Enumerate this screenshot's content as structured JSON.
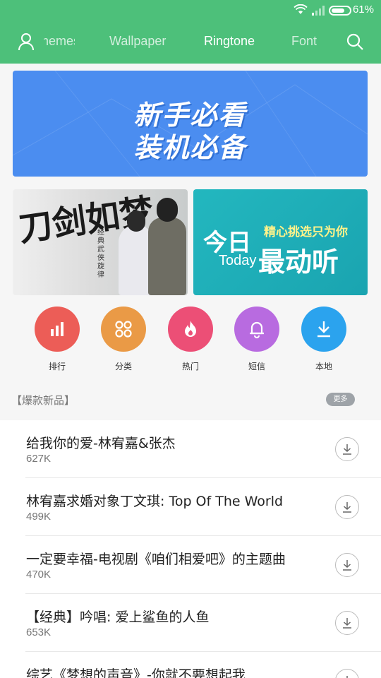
{
  "status_bar": {
    "battery_percent": "61%"
  },
  "nav": {
    "tabs": [
      {
        "label": "Themes"
      },
      {
        "label": "Wallpaper"
      },
      {
        "label": "Ringtone"
      },
      {
        "label": "Font"
      }
    ],
    "active_tab": "Ringtone"
  },
  "banners": {
    "main": {
      "line1": "新手必看",
      "line2": "装机必备"
    },
    "left": {
      "title": "刀剑如梦",
      "subtitle": "经典武侠旋律"
    },
    "right": {
      "line1": "今日",
      "sub": "精心挑选只为你",
      "today": "Today",
      "line2": "最动听"
    }
  },
  "categories": [
    {
      "label": "排行",
      "icon": "bar-chart-icon",
      "color": "#ec5d57"
    },
    {
      "label": "分类",
      "icon": "grid-icon",
      "color": "#ea9a46"
    },
    {
      "label": "热门",
      "icon": "flame-icon",
      "color": "#ec4f76"
    },
    {
      "label": "短信",
      "icon": "bell-icon",
      "color": "#b86be0"
    },
    {
      "label": "本地",
      "icon": "download-icon",
      "color": "#2ba3ee"
    }
  ],
  "section": {
    "title": "【爆款新品】",
    "more_label": "更多"
  },
  "ringtones": [
    {
      "title": "给我你的爱-林宥嘉&张杰",
      "size": "627K"
    },
    {
      "title": "林宥嘉求婚对象丁文琪: Top Of The World",
      "size": "499K"
    },
    {
      "title": "一定要幸福-电视剧《咱们相爱吧》的主题曲",
      "size": "470K"
    },
    {
      "title": "【经典】吟唱: 爱上鲨鱼的人鱼",
      "size": "653K"
    },
    {
      "title": "综艺《梦想的声音》-你就不要想起我",
      "size": ""
    }
  ]
}
